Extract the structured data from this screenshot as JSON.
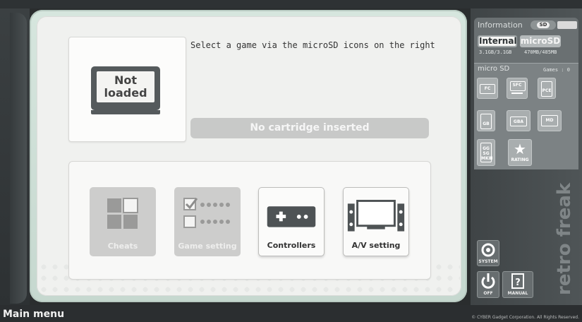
{
  "cartridge": {
    "label": "Not loaded"
  },
  "instruction": "Select a game via the microSD icons on the right",
  "status": "No cartridge inserted",
  "menu": {
    "tiles": [
      {
        "label": "Cheats",
        "enabled": false
      },
      {
        "label": "Game setting",
        "enabled": false
      },
      {
        "label": "Controllers",
        "enabled": true
      },
      {
        "label": "A/V setting",
        "enabled": true
      }
    ]
  },
  "info_panel": {
    "title": "Information",
    "sd_chip": "SD",
    "internal_label": "Internal",
    "micro_label": "microSD",
    "internal_capacity": "3.1GB/3.1GB",
    "micro_capacity": "470MB/485MB"
  },
  "microsd_panel": {
    "title": "micro SD",
    "games_count": "Games : 0",
    "systems": [
      "FC",
      "SFC",
      "PCE",
      "GB",
      "GBA",
      "MD",
      "GG SG MKⅢ"
    ],
    "rating_label": "RATING"
  },
  "brand": "retro freak",
  "controls": {
    "system_label": "SYSTEM",
    "off_label": "OFF",
    "manual_label": "MANUAL"
  },
  "footer": {
    "title": "Main menu",
    "copyright": "© CYBER Gadget Corporation. All Rights Reserved."
  },
  "colors": {
    "panel_green": "#d6e6de",
    "sidebar": "#4f5557",
    "disabled_tile": "#cdcdcc"
  }
}
